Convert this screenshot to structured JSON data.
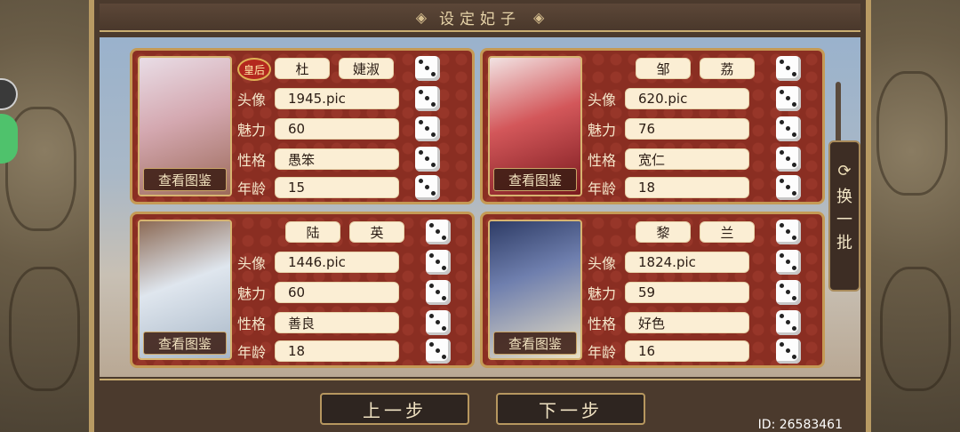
{
  "header": {
    "title": "设定妃子",
    "ornament_left": "◈",
    "ornament_right": "◈"
  },
  "labels": {
    "avatar": "头像",
    "charm": "魅力",
    "personality": "性格",
    "age": "年龄"
  },
  "view_button_label": "查看图鉴",
  "queen_badge": "皇后",
  "consorts": [
    {
      "surname": "杜",
      "given": "婕淑",
      "avatar": "1945.pic",
      "charm": "60",
      "personality": "愚笨",
      "age": "15",
      "is_queen": true,
      "portrait_color": "#c97f86"
    },
    {
      "surname": "邹",
      "given": "荔",
      "avatar": "620.pic",
      "charm": "76",
      "personality": "宽仁",
      "age": "18",
      "is_queen": false,
      "portrait_color": "#b52a2e"
    },
    {
      "surname": "陆",
      "given": "英",
      "avatar": "1446.pic",
      "charm": "60",
      "personality": "善良",
      "age": "18",
      "is_queen": false,
      "portrait_color": "#c8d2dc"
    },
    {
      "surname": "黎",
      "given": "兰",
      "avatar": "1824.pic",
      "charm": "59",
      "personality": "好色",
      "age": "16",
      "is_queen": false,
      "portrait_color": "#3e4f7a"
    }
  ],
  "swap_button": {
    "icon": "refresh-icon",
    "chars": [
      "换",
      "一",
      "批"
    ]
  },
  "footer": {
    "prev_label": "上一步",
    "next_label": "下一步",
    "id_text": "ID: 26583461"
  },
  "colors": {
    "card_bg": "#8a2e22",
    "gold": "#c59a55",
    "pill": "#fbeed4"
  }
}
